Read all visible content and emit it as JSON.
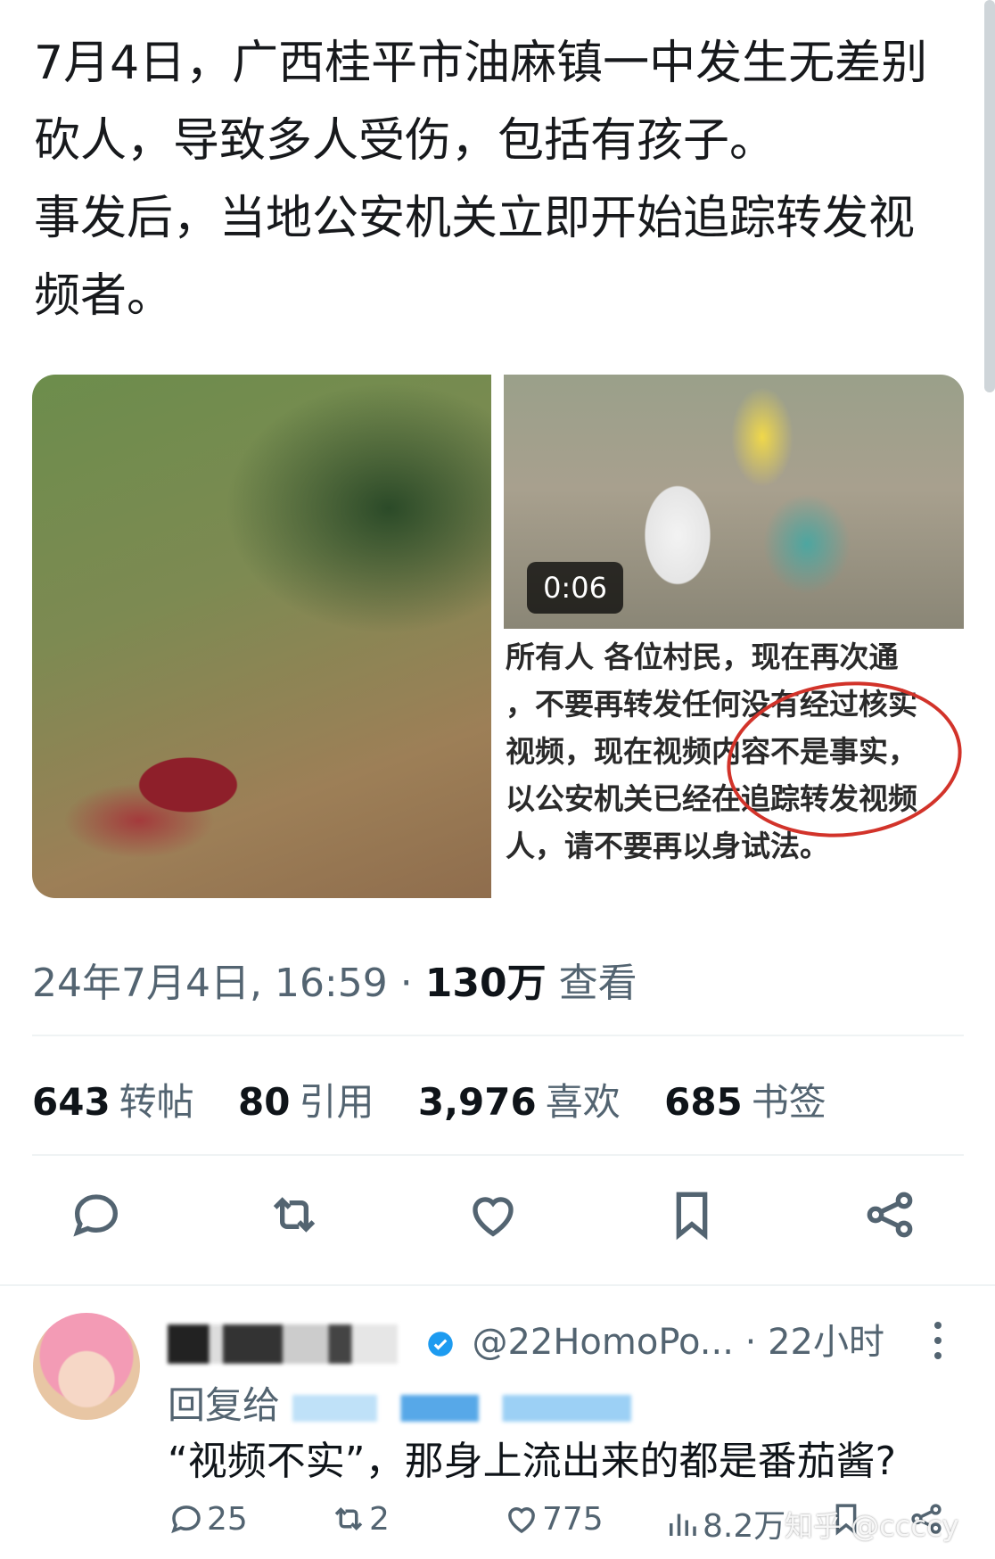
{
  "post": {
    "lines": [
      "7月4日，广西桂平市油麻镇一中发生无差别",
      "砍人，导致多人受伤，包括有孩子。",
      "事发后，当地公安机关立即开始追踪转发视",
      "频者。"
    ],
    "media": {
      "video_duration": "0:06",
      "notice_lines": [
        "所有人  各位村民，现在再次通",
        "，不要再转发任何没有经过核实",
        "视频，现在视频内容不是事实，",
        "以公安机关已经在追踪转发视频",
        "人，请不要再以身试法。"
      ]
    },
    "meta": {
      "datetime": "24年7月4日, 16:59",
      "separator": "·",
      "views_count": "130万",
      "views_label": "查看"
    },
    "stats": [
      {
        "count": "643",
        "label": "转帖"
      },
      {
        "count": "80",
        "label": "引用"
      },
      {
        "count": "3,976",
        "label": "喜欢"
      },
      {
        "count": "685",
        "label": "书签"
      }
    ],
    "actions": [
      "reply-icon",
      "retweet-icon",
      "like-icon",
      "bookmark-icon",
      "share-icon"
    ]
  },
  "reply": {
    "handle": "@22HomoPo...",
    "time": "· 22小时",
    "reply_to_label": "回复给",
    "text": "“视频不实”，那身上流出来的都是番茄酱?",
    "counts": {
      "replies": "25",
      "retweets": "2",
      "likes": "775",
      "views": "8.2万"
    }
  },
  "watermark": "知乎 @ccccy",
  "colors": {
    "text": "#0f1419",
    "secondary": "#536471",
    "divider": "#eff3f4",
    "verified": "#1d9bf0",
    "annotation_red": "#d2332a"
  }
}
